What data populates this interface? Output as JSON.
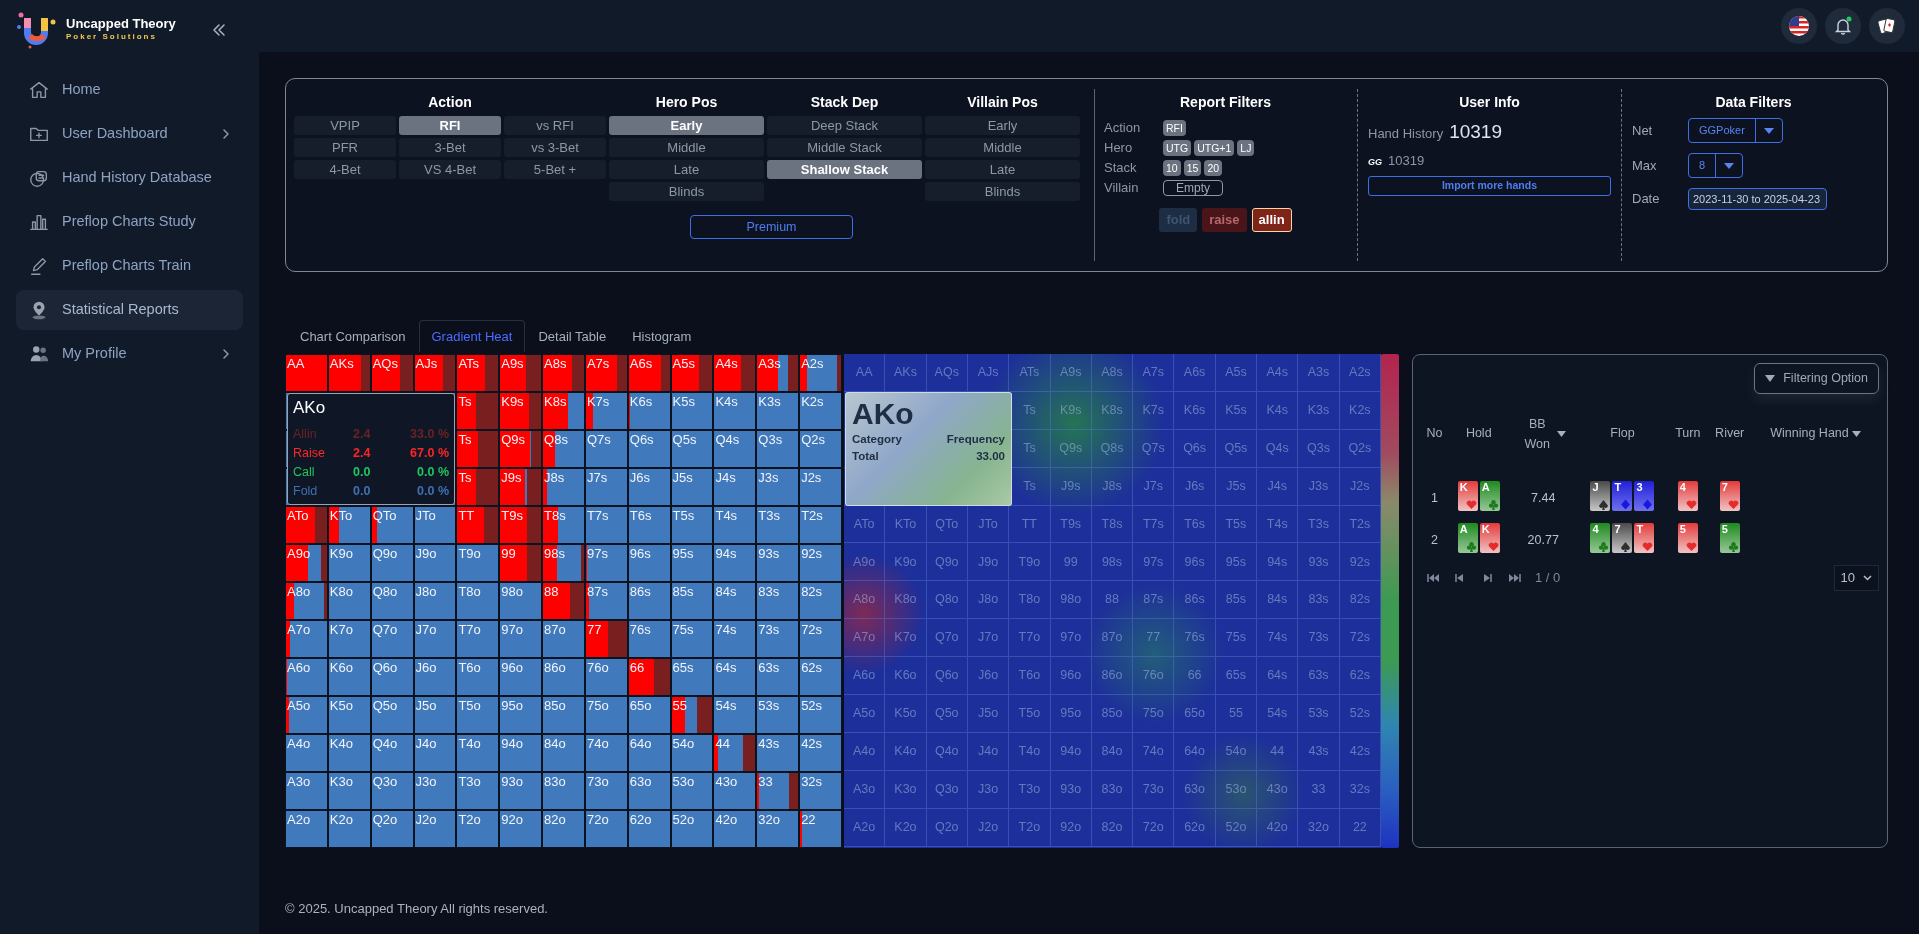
{
  "brand": {
    "name": "Uncapped Theory",
    "tagline": "Poker Solutions"
  },
  "sidebar": {
    "items": [
      {
        "label": "Home",
        "selected": false,
        "has_submenu": false
      },
      {
        "label": "User Dashboard",
        "selected": false,
        "has_submenu": true
      },
      {
        "label": "Hand History Database",
        "selected": false,
        "has_submenu": false
      },
      {
        "label": "Preflop Charts Study",
        "selected": false,
        "has_submenu": false
      },
      {
        "label": "Preflop Charts Train",
        "selected": false,
        "has_submenu": false
      },
      {
        "label": "Statistical Reports",
        "selected": true,
        "has_submenu": false
      },
      {
        "label": "My Profile",
        "selected": false,
        "has_submenu": true
      }
    ]
  },
  "filters": {
    "groups": [
      {
        "title": "Action",
        "kind": "grid",
        "options": [
          {
            "label": "VPIP",
            "selected": false
          },
          {
            "label": "RFI",
            "selected": true
          },
          {
            "label": "vs RFI",
            "selected": false
          },
          {
            "label": "PFR",
            "selected": false
          },
          {
            "label": "3-Bet",
            "selected": false
          },
          {
            "label": "vs 3-Bet",
            "selected": false
          },
          {
            "label": "4-Bet",
            "selected": false
          },
          {
            "label": "VS 4-Bet",
            "selected": false
          },
          {
            "label": "5-Bet +",
            "selected": false
          }
        ]
      },
      {
        "title": "Hero Pos",
        "kind": "list",
        "options": [
          {
            "label": "Early",
            "selected": true
          },
          {
            "label": "Middle",
            "selected": false
          },
          {
            "label": "Late",
            "selected": false
          },
          {
            "label": "Blinds",
            "selected": false
          }
        ]
      },
      {
        "title": "Stack Dep",
        "kind": "list",
        "options": [
          {
            "label": "Deep Stack",
            "selected": false
          },
          {
            "label": "Middle Stack",
            "selected": false
          },
          {
            "label": "Shallow Stack",
            "selected": true
          }
        ]
      },
      {
        "title": "Villain Pos",
        "kind": "list",
        "options": [
          {
            "label": "Early",
            "selected": false
          },
          {
            "label": "Middle",
            "selected": false
          },
          {
            "label": "Late",
            "selected": false
          },
          {
            "label": "Blinds",
            "selected": false
          }
        ]
      }
    ],
    "premium_button": "Premium"
  },
  "report_filters": {
    "title": "Report Filters",
    "rows": [
      {
        "label": "Action",
        "chips": [
          {
            "text": "RFI",
            "kind": "tag"
          }
        ]
      },
      {
        "label": "Hero",
        "chips": [
          {
            "text": "UTG",
            "kind": "tag"
          },
          {
            "text": "UTG+1",
            "kind": "tag"
          },
          {
            "text": "LJ",
            "kind": "tag"
          }
        ]
      },
      {
        "label": "Stack",
        "chips": [
          {
            "text": "10",
            "kind": "tag"
          },
          {
            "text": "15",
            "kind": "tag"
          },
          {
            "text": "20",
            "kind": "tag"
          }
        ]
      },
      {
        "label": "Villain",
        "chips": [
          {
            "text": "Empty",
            "kind": "empty"
          }
        ]
      }
    ],
    "legend": [
      {
        "label": "fold",
        "kind": "fold",
        "on": false
      },
      {
        "label": "raise",
        "kind": "raise",
        "on": false
      },
      {
        "label": "allin",
        "kind": "allin",
        "on": true
      }
    ]
  },
  "user_info": {
    "title": "User Info",
    "hand_history_label": "Hand History",
    "hand_history_count": "10319",
    "site_badge": "GG",
    "site_count": "10319",
    "import_button": "Import more hands"
  },
  "data_filters": {
    "title": "Data Filters",
    "net": {
      "label": "Net",
      "value": "GGPoker"
    },
    "max": {
      "label": "Max",
      "value": "8"
    },
    "date": {
      "label": "Date",
      "value": "2023-11-30 to 2025-04-23"
    }
  },
  "tabs": [
    {
      "label": "Chart Comparison",
      "selected": false
    },
    {
      "label": "Gradient Heat",
      "selected": true
    },
    {
      "label": "Detail Table",
      "selected": false
    },
    {
      "label": "Histogram",
      "selected": false
    }
  ],
  "hand_grid": {
    "rows": [
      [
        {
          "label": "AA",
          "bars": [
            {
              "kind": "raise",
              "level": 1
            }
          ]
        },
        {
          "label": "AKs",
          "bars": [
            {
              "kind": "raise",
              "level": 0.78
            },
            {
              "kind": "allin",
              "level": 0.22
            }
          ]
        },
        {
          "label": "AQs",
          "bars": [
            {
              "kind": "raise",
              "level": 0.7
            },
            {
              "kind": "allin",
              "level": 0.3
            }
          ]
        },
        {
          "label": "AJs",
          "bars": [
            {
              "kind": "raise",
              "level": 0.7
            },
            {
              "kind": "allin",
              "level": 0.3
            }
          ]
        },
        {
          "label": "ATs",
          "bars": [
            {
              "kind": "raise",
              "level": 0.68
            },
            {
              "kind": "allin",
              "level": 0.32
            }
          ]
        },
        {
          "label": "A9s",
          "bars": [
            {
              "kind": "raise",
              "level": 0.62
            },
            {
              "kind": "allin",
              "level": 0.38
            }
          ]
        },
        {
          "label": "A8s",
          "bars": [
            {
              "kind": "raise",
              "level": 0.72
            },
            {
              "kind": "allin",
              "level": 0.28
            }
          ]
        },
        {
          "label": "A7s",
          "bars": [
            {
              "kind": "raise",
              "level": 0.75
            },
            {
              "kind": "allin",
              "level": 0.25
            }
          ]
        },
        {
          "label": "A6s",
          "bars": [
            {
              "kind": "raise",
              "level": 0.78
            },
            {
              "kind": "allin",
              "level": 0.22
            }
          ]
        },
        {
          "label": "A5s",
          "bars": [
            {
              "kind": "raise",
              "level": 0.68
            },
            {
              "kind": "allin",
              "level": 0.32
            }
          ]
        },
        {
          "label": "A4s",
          "bars": [
            {
              "kind": "raise",
              "level": 0.65
            },
            {
              "kind": "allin",
              "level": 0.35
            }
          ]
        },
        {
          "label": "A3s",
          "bars": [
            {
              "kind": "raise",
              "level": 0.5
            },
            {
              "kind": "allin",
              "level": 0.25
            }
          ]
        },
        {
          "label": "A2s",
          "bars": [
            {
              "kind": "raise",
              "level": 0.18
            },
            {
              "kind": "allin",
              "level": 0.1
            }
          ]
        }
      ],
      [
        null,
        null,
        null,
        null,
        {
          "label": "Ts",
          "bars": [
            {
              "kind": "raise",
              "level": 0.45
            },
            {
              "kind": "allin",
              "level": 0.55
            }
          ]
        },
        {
          "label": "K9s",
          "bars": [
            {
              "kind": "raise",
              "level": 0.7
            },
            {
              "kind": "allin",
              "level": 0.3
            }
          ]
        },
        {
          "label": "K8s",
          "bars": [
            {
              "kind": "raise",
              "level": 0.6
            }
          ]
        },
        {
          "label": "K7s",
          "bars": [
            {
              "kind": "raise",
              "level": 0.17
            }
          ]
        },
        {
          "label": "K6s",
          "bars": [
            {
              "kind": "raise",
              "level": 0.03
            }
          ]
        },
        {
          "label": "K5s"
        },
        {
          "label": "K4s"
        },
        {
          "label": "K3s"
        },
        {
          "label": "K2s"
        }
      ],
      [
        null,
        null,
        null,
        null,
        {
          "label": "Ts",
          "bars": [
            {
              "kind": "raise",
              "level": 0.5
            },
            {
              "kind": "allin",
              "level": 0.5
            }
          ]
        },
        {
          "label": "Q9s",
          "bars": [
            {
              "kind": "raise",
              "level": 0.72
            },
            {
              "kind": "allin",
              "level": 0.25
            }
          ]
        },
        {
          "label": "Q8s",
          "bars": [
            {
              "kind": "raise",
              "level": 0.28
            }
          ]
        },
        {
          "label": "Q7s"
        },
        {
          "label": "Q6s"
        },
        {
          "label": "Q5s"
        },
        {
          "label": "Q4s"
        },
        {
          "label": "Q3s"
        },
        {
          "label": "Q2s"
        }
      ],
      [
        null,
        null,
        null,
        null,
        {
          "label": "Ts",
          "bars": [
            {
              "kind": "raise",
              "level": 0.45
            },
            {
              "kind": "allin",
              "level": 0.55
            }
          ]
        },
        {
          "label": "J9s",
          "bars": [
            {
              "kind": "raise",
              "level": 0.6
            },
            {
              "kind": "allin",
              "level": 0.35
            }
          ]
        },
        {
          "label": "J8s",
          "bars": [
            {
              "kind": "raise",
              "level": 0.1
            }
          ]
        },
        {
          "label": "J7s"
        },
        {
          "label": "J6s"
        },
        {
          "label": "J5s"
        },
        {
          "label": "J4s"
        },
        {
          "label": "J3s"
        },
        {
          "label": "J2s"
        }
      ],
      [
        {
          "label": "ATo",
          "bars": [
            {
              "kind": "raise",
              "level": 0.7
            },
            {
              "kind": "allin",
              "level": 0.3
            }
          ]
        },
        {
          "label": "KTo",
          "bars": [
            {
              "kind": "raise",
              "level": 0.25
            }
          ]
        },
        {
          "label": "QTo",
          "bars": [
            {
              "kind": "raise",
              "level": 0.12
            }
          ]
        },
        {
          "label": "JTo"
        },
        {
          "label": "TT",
          "bars": [
            {
              "kind": "raise",
              "level": 0.65
            },
            {
              "kind": "allin",
              "level": 0.35
            }
          ]
        },
        {
          "label": "T9s",
          "bars": [
            {
              "kind": "raise",
              "level": 0.65
            },
            {
              "kind": "allin",
              "level": 0.35
            }
          ]
        },
        {
          "label": "T8s",
          "bars": [
            {
              "kind": "raise",
              "level": 0.36
            }
          ]
        },
        {
          "label": "T7s"
        },
        {
          "label": "T6s"
        },
        {
          "label": "T5s"
        },
        {
          "label": "T4s"
        },
        {
          "label": "T3s"
        },
        {
          "label": "T2s"
        }
      ],
      [
        {
          "label": "A9o",
          "bars": [
            {
              "kind": "raise",
              "level": 0.55
            },
            {
              "kind": "allin",
              "level": 0.15
            }
          ]
        },
        {
          "label": "K9o"
        },
        {
          "label": "Q9o"
        },
        {
          "label": "J9o"
        },
        {
          "label": "T9o"
        },
        {
          "label": "99",
          "bars": [
            {
              "kind": "raise",
              "level": 0.65
            },
            {
              "kind": "allin",
              "level": 0.35
            }
          ]
        },
        {
          "label": "98s",
          "bars": [
            {
              "kind": "raise",
              "level": 0.35
            },
            {
              "kind": "allin",
              "level": 0.08
            }
          ]
        },
        {
          "label": "97s",
          "bars": [
            {
              "kind": "raise",
              "level": 0.03
            }
          ]
        },
        {
          "label": "96s"
        },
        {
          "label": "95s"
        },
        {
          "label": "94s"
        },
        {
          "label": "93s"
        },
        {
          "label": "92s"
        }
      ],
      [
        {
          "label": "A8o",
          "bars": [
            {
              "kind": "raise",
              "level": 0.2
            },
            {
              "kind": "allin",
              "level": 0.08
            }
          ]
        },
        {
          "label": "K8o"
        },
        {
          "label": "Q8o"
        },
        {
          "label": "J8o"
        },
        {
          "label": "T8o"
        },
        {
          "label": "98o"
        },
        {
          "label": "88",
          "bars": [
            {
              "kind": "raise",
              "level": 0.65
            },
            {
              "kind": "allin",
              "level": 0.35
            }
          ]
        },
        {
          "label": "87s",
          "bars": [
            {
              "kind": "raise",
              "level": 0.08
            }
          ]
        },
        {
          "label": "86s"
        },
        {
          "label": "85s"
        },
        {
          "label": "84s"
        },
        {
          "label": "83s"
        },
        {
          "label": "82s"
        }
      ],
      [
        {
          "label": "A7o",
          "bars": [
            {
              "kind": "raise",
              "level": 0.1
            }
          ]
        },
        {
          "label": "K7o"
        },
        {
          "label": "Q7o"
        },
        {
          "label": "J7o"
        },
        {
          "label": "T7o"
        },
        {
          "label": "97o"
        },
        {
          "label": "87o"
        },
        {
          "label": "77",
          "bars": [
            {
              "kind": "raise",
              "level": 0.55
            },
            {
              "kind": "allin",
              "level": 0.45
            }
          ]
        },
        {
          "label": "76s"
        },
        {
          "label": "75s"
        },
        {
          "label": "74s"
        },
        {
          "label": "73s"
        },
        {
          "label": "72s"
        }
      ],
      [
        {
          "label": "A6o",
          "bars": [
            {
              "kind": "raise",
              "level": 0.03
            }
          ]
        },
        {
          "label": "K6o"
        },
        {
          "label": "Q6o"
        },
        {
          "label": "J6o"
        },
        {
          "label": "T6o"
        },
        {
          "label": "96o"
        },
        {
          "label": "86o"
        },
        {
          "label": "76o"
        },
        {
          "label": "66",
          "bars": [
            {
              "kind": "raise",
              "level": 0.62
            },
            {
              "kind": "allin",
              "level": 0.38
            }
          ]
        },
        {
          "label": "65s"
        },
        {
          "label": "64s"
        },
        {
          "label": "63s"
        },
        {
          "label": "62s"
        }
      ],
      [
        {
          "label": "A5o",
          "bars": [
            {
              "kind": "raise",
              "level": 0.08
            }
          ]
        },
        {
          "label": "K5o"
        },
        {
          "label": "Q5o"
        },
        {
          "label": "J5o"
        },
        {
          "label": "T5o"
        },
        {
          "label": "95o"
        },
        {
          "label": "85o"
        },
        {
          "label": "75o"
        },
        {
          "label": "65o"
        },
        {
          "label": "55",
          "bars": [
            {
              "kind": "raise",
              "level": 0.33
            },
            {
              "kind": "allin",
              "level": 0.37
            }
          ]
        },
        {
          "label": "54s"
        },
        {
          "label": "53s"
        },
        {
          "label": "52s"
        }
      ],
      [
        {
          "label": "A4o"
        },
        {
          "label": "K4o"
        },
        {
          "label": "Q4o"
        },
        {
          "label": "J4o"
        },
        {
          "label": "T4o"
        },
        {
          "label": "94o"
        },
        {
          "label": "84o"
        },
        {
          "label": "74o"
        },
        {
          "label": "64o"
        },
        {
          "label": "54o"
        },
        {
          "label": "44",
          "bars": [
            {
              "kind": "raise",
              "level": 0.08
            },
            {
              "kind": "allin",
              "level": 0.3
            }
          ]
        },
        {
          "label": "43s"
        },
        {
          "label": "42s"
        }
      ],
      [
        {
          "label": "A3o"
        },
        {
          "label": "K3o"
        },
        {
          "label": "Q3o"
        },
        {
          "label": "J3o"
        },
        {
          "label": "T3o"
        },
        {
          "label": "93o"
        },
        {
          "label": "83o"
        },
        {
          "label": "73o"
        },
        {
          "label": "63o"
        },
        {
          "label": "53o"
        },
        {
          "label": "43o"
        },
        {
          "label": "33",
          "bars": [
            {
              "kind": "raise",
              "level": 0.03
            },
            {
              "kind": "allin",
              "level": 0.22
            }
          ]
        },
        {
          "label": "32s"
        }
      ],
      [
        {
          "label": "A2o"
        },
        {
          "label": "K2o"
        },
        {
          "label": "Q2o"
        },
        {
          "label": "J2o"
        },
        {
          "label": "T2o"
        },
        {
          "label": "92o"
        },
        {
          "label": "82o"
        },
        {
          "label": "72o"
        },
        {
          "label": "62o"
        },
        {
          "label": "52o"
        },
        {
          "label": "42o"
        },
        {
          "label": "32o"
        },
        {
          "label": "22",
          "bars": [
            {
              "kind": "raise",
              "level": 0.05
            }
          ]
        }
      ]
    ],
    "tooltip": {
      "title": "AKo",
      "rows": [
        {
          "kind": "allin",
          "label": "Allin",
          "count": "2.4",
          "percent": "33.0 %"
        },
        {
          "kind": "raise",
          "label": "Raise",
          "count": "2.4",
          "percent": "67.0 %"
        },
        {
          "kind": "call",
          "label": "Call",
          "count": "0.0",
          "percent": "0.0 %"
        },
        {
          "kind": "fold",
          "label": "Fold",
          "count": "0.0",
          "percent": "0.0 %"
        }
      ]
    }
  },
  "heat_grid": {
    "rows": [
      [
        "AA",
        "AKs",
        "AQs",
        "AJs",
        "ATs",
        "A9s",
        "A8s",
        "A7s",
        "A6s",
        "A5s",
        "A4s",
        "A3s",
        "A2s"
      ],
      [
        null,
        null,
        null,
        null,
        "Ts",
        "K9s",
        "K8s",
        "K7s",
        "K6s",
        "K5s",
        "K4s",
        "K3s",
        "K2s"
      ],
      [
        null,
        null,
        null,
        null,
        "Ts",
        "Q9s",
        "Q8s",
        "Q7s",
        "Q6s",
        "Q5s",
        "Q4s",
        "Q3s",
        "Q2s"
      ],
      [
        null,
        null,
        null,
        null,
        "Ts",
        "J9s",
        "J8s",
        "J7s",
        "J6s",
        "J5s",
        "J4s",
        "J3s",
        "J2s"
      ],
      [
        "ATo",
        "KTo",
        "QTo",
        "JTo",
        "TT",
        "T9s",
        "T8s",
        "T7s",
        "T6s",
        "T5s",
        "T4s",
        "T3s",
        "T2s"
      ],
      [
        "A9o",
        "K9o",
        "Q9o",
        "J9o",
        "T9o",
        "99",
        "98s",
        "97s",
        "96s",
        "95s",
        "94s",
        "93s",
        "92s"
      ],
      [
        "A8o",
        "K8o",
        "Q8o",
        "J8o",
        "T8o",
        "98o",
        "88",
        "87s",
        "86s",
        "85s",
        "84s",
        "83s",
        "82s"
      ],
      [
        "A7o",
        "K7o",
        "Q7o",
        "J7o",
        "T7o",
        "97o",
        "87o",
        "77",
        "76s",
        "75s",
        "74s",
        "73s",
        "72s"
      ],
      [
        "A6o",
        "K6o",
        "Q6o",
        "J6o",
        "T6o",
        "96o",
        "86o",
        "76o",
        "66",
        "65s",
        "64s",
        "63s",
        "62s"
      ],
      [
        "A5o",
        "K5o",
        "Q5o",
        "J5o",
        "T5o",
        "95o",
        "85o",
        "75o",
        "65o",
        "55",
        "54s",
        "53s",
        "52s"
      ],
      [
        "A4o",
        "K4o",
        "Q4o",
        "J4o",
        "T4o",
        "94o",
        "84o",
        "74o",
        "64o",
        "54o",
        "44",
        "43s",
        "42s"
      ],
      [
        "A3o",
        "K3o",
        "Q3o",
        "J3o",
        "T3o",
        "93o",
        "83o",
        "73o",
        "63o",
        "53o",
        "43o",
        "33",
        "32s"
      ],
      [
        "A2o",
        "K2o",
        "Q2o",
        "J2o",
        "T2o",
        "92o",
        "82o",
        "72o",
        "62o",
        "52o",
        "42o",
        "32o",
        "22"
      ]
    ],
    "tooltip": {
      "title": "AKo",
      "headers": [
        "Category",
        "Frequency"
      ],
      "row": [
        "Total",
        "33.00"
      ]
    }
  },
  "hands_panel": {
    "filter_button": "Filtering Option",
    "columns": [
      {
        "label": "No",
        "sortable": false
      },
      {
        "label": "Hold",
        "sortable": false
      },
      {
        "label": "BB Won",
        "sortable": true
      },
      {
        "label": "Flop",
        "sortable": false
      },
      {
        "label": "Turn",
        "sortable": false
      },
      {
        "label": "River",
        "sortable": false
      },
      {
        "label": "Winning Hand",
        "sortable": true
      }
    ],
    "rows": [
      {
        "no": "1",
        "hold": [
          {
            "rank": "K",
            "kind": "hearts"
          },
          {
            "rank": "A",
            "kind": "clubs"
          }
        ],
        "bb_won": "7.44",
        "flop": [
          {
            "rank": "J",
            "kind": "spades"
          },
          {
            "rank": "T",
            "kind": "diamonds"
          },
          {
            "rank": "3",
            "kind": "diamonds"
          }
        ],
        "turn": [
          {
            "rank": "4",
            "kind": "hearts"
          }
        ],
        "river": [
          {
            "rank": "7",
            "kind": "hearts"
          }
        ]
      },
      {
        "no": "2",
        "hold": [
          {
            "rank": "A",
            "kind": "clubs"
          },
          {
            "rank": "K",
            "kind": "hearts"
          }
        ],
        "bb_won": "20.77",
        "flop": [
          {
            "rank": "4",
            "kind": "clubs"
          },
          {
            "rank": "7",
            "kind": "spades"
          },
          {
            "rank": "T",
            "kind": "hearts"
          }
        ],
        "turn": [
          {
            "rank": "5",
            "kind": "hearts"
          }
        ],
        "river": [
          {
            "rank": "5",
            "kind": "clubs"
          }
        ]
      }
    ],
    "pagination": {
      "page": "1 / 0",
      "page_size": "10"
    }
  },
  "footer": "© 2025. Uncapped Theory All rights reserved."
}
